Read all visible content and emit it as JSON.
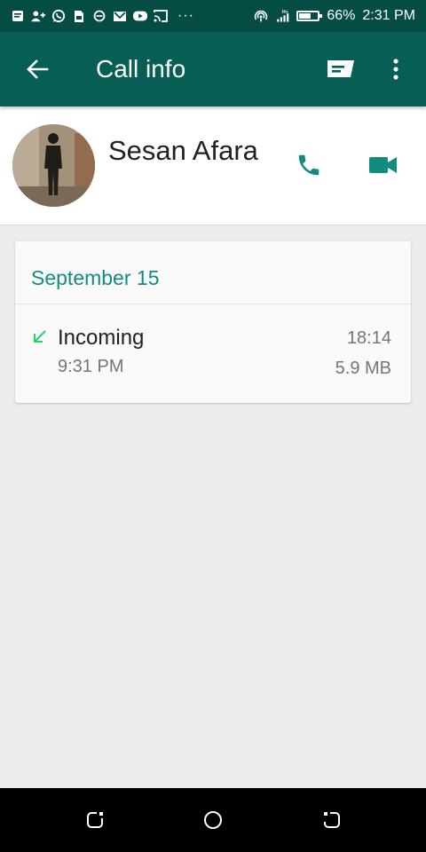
{
  "status_bar": {
    "battery": "66%",
    "time": "2:31 PM",
    "network": "H+",
    "battery_level": 0.66,
    "notification_icons": [
      "message-icon",
      "add-contact-icon",
      "whatsapp-icon",
      "file-icon",
      "block-icon",
      "gmail-icon",
      "youtube-icon",
      "cast-icon"
    ]
  },
  "app_bar": {
    "title": "Call info",
    "back_icon": "arrow-back-icon",
    "message_icon": "message-icon",
    "more_icon": "more-vert-icon"
  },
  "contact": {
    "name": "Sesan Afara",
    "actions": [
      "voice-call-icon",
      "video-call-icon"
    ]
  },
  "call_log": {
    "date": "September 15",
    "entries": [
      {
        "type": "Incoming",
        "time": "9:31 PM",
        "duration": "18:14",
        "size": "5.9 MB",
        "direction_icon": "incoming-arrow-icon"
      }
    ]
  },
  "nav_bar": {
    "buttons": [
      "recent-apps-icon",
      "home-icon",
      "back-icon"
    ]
  },
  "colors": {
    "status_bar": "#054d44",
    "app_bar": "#075e54",
    "accent": "#128c7e",
    "incoming_arrow": "#25d366",
    "background": "#ececec"
  }
}
